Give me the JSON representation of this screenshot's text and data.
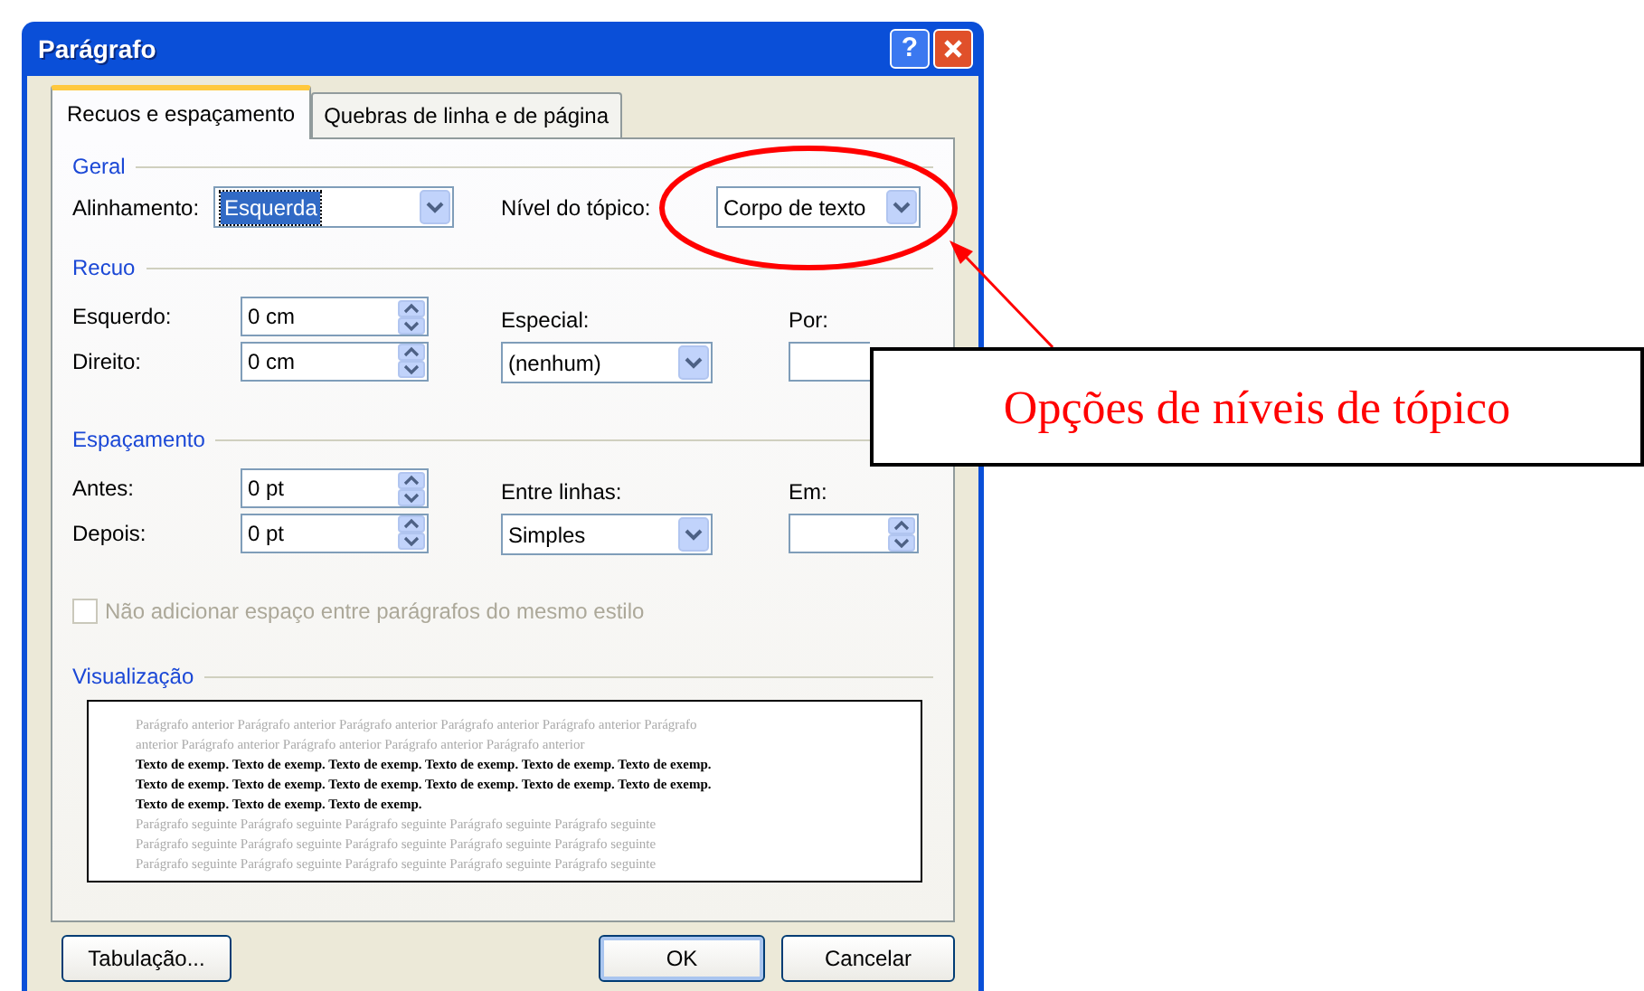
{
  "window": {
    "title": "Parágrafo"
  },
  "title_buttons": [
    {
      "kind": "help",
      "label": "?"
    },
    {
      "kind": "close"
    }
  ],
  "tabs": [
    {
      "label": "Recuos e espaçamento",
      "selected": true
    },
    {
      "label": "Quebras de linha e de página",
      "selected": false
    }
  ],
  "general": {
    "heading": "Geral",
    "alignment": {
      "label": "Alinhamento:",
      "value": "Esquerda",
      "focused": true
    },
    "outline_level": {
      "label": "Nível do tópico:",
      "value": "Corpo de texto",
      "focused": false
    }
  },
  "indent": {
    "heading": "Recuo",
    "left": {
      "label": "Esquerdo:",
      "value": "0 cm"
    },
    "right": {
      "label": "Direito:",
      "value": "0 cm"
    },
    "special": {
      "label": "Especial:",
      "value": "(nenhum)"
    },
    "by": {
      "label": "Por:"
    }
  },
  "spacing": {
    "heading": "Espaçamento",
    "before": {
      "label": "Antes:",
      "value": "0 pt"
    },
    "after": {
      "label": "Depois:",
      "value": "0 pt"
    },
    "line_spacing": {
      "label": "Entre linhas:",
      "value": "Simples"
    },
    "at": {
      "label": "Em:"
    }
  },
  "checkbox": {
    "label": "Não adicionar espaço entre parágrafos do mesmo estilo",
    "checked": false,
    "disabled": true
  },
  "preview": {
    "heading": "Visualização",
    "lines": [
      {
        "kind": "context",
        "text": "Parágrafo anterior Parágrafo anterior Parágrafo anterior Parágrafo anterior Parágrafo anterior Parágrafo"
      },
      {
        "kind": "context",
        "text": "anterior Parágrafo anterior Parágrafo anterior Parágrafo anterior Parágrafo anterior"
      },
      {
        "kind": "sample",
        "text": "Texto de exemp. Texto de exemp. Texto de exemp. Texto de exemp. Texto de exemp. Texto de exemp."
      },
      {
        "kind": "sample",
        "text": "Texto de exemp. Texto de exemp. Texto de exemp. Texto de exemp. Texto de exemp. Texto de exemp."
      },
      {
        "kind": "sample",
        "text": "Texto de exemp. Texto de exemp. Texto de exemp."
      },
      {
        "kind": "context",
        "text": "Parágrafo seguinte Parágrafo seguinte Parágrafo seguinte Parágrafo seguinte Parágrafo seguinte"
      },
      {
        "kind": "context",
        "text": "Parágrafo seguinte Parágrafo seguinte Parágrafo seguinte Parágrafo seguinte Parágrafo seguinte"
      },
      {
        "kind": "context",
        "text": "Parágrafo seguinte Parágrafo seguinte Parágrafo seguinte Parágrafo seguinte Parágrafo seguinte"
      }
    ]
  },
  "buttons": [
    {
      "label": "Tabulação...",
      "default": false
    },
    {
      "label": "OK",
      "default": true
    },
    {
      "label": "Cancelar",
      "default": false
    }
  ],
  "callout": {
    "text": "Opções de níveis de tópico"
  }
}
